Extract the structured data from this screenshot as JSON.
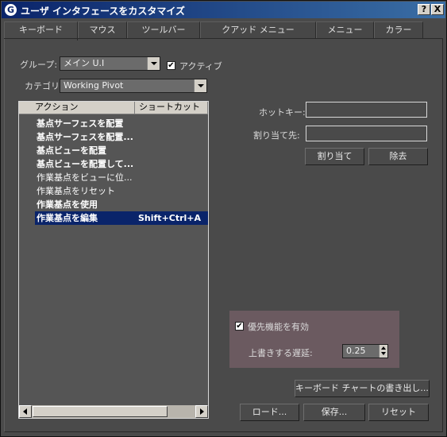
{
  "window": {
    "title": "ユーザ インタフェースをカスタマイズ",
    "help_label": "?",
    "close_label": "X"
  },
  "tabs": [
    {
      "label": "キーボード"
    },
    {
      "label": "マウス"
    },
    {
      "label": "ツールバー"
    },
    {
      "label": "クアッド メニュー"
    },
    {
      "label": "メニュー"
    },
    {
      "label": "カラー"
    }
  ],
  "group": {
    "label": "グループ:",
    "value": "メイン U.I",
    "active_label": "アクティブ",
    "active_checked": true
  },
  "category": {
    "label": "カテゴリ:",
    "value": "Working Pivot"
  },
  "list": {
    "col_action": "アクション",
    "col_shortcut": "ショートカット",
    "rows": [
      {
        "action": "基点サーフェスを配置",
        "shortcut": ""
      },
      {
        "action": "基点サーフェスを配置...",
        "shortcut": ""
      },
      {
        "action": "基点ビューを配置",
        "shortcut": ""
      },
      {
        "action": "基点ビューを配置して...",
        "shortcut": ""
      },
      {
        "action": "作業基点をビューに位...",
        "shortcut": ""
      },
      {
        "action": "作業基点をリセット",
        "shortcut": ""
      },
      {
        "action": "作業基点を使用",
        "shortcut": ""
      },
      {
        "action": "作業基点を編集",
        "shortcut": "Shift+Ctrl+A"
      }
    ]
  },
  "hotkey": {
    "label": "ホットキー:",
    "value": ""
  },
  "assigned_to": {
    "label": "割り当て先:",
    "value": ""
  },
  "buttons": {
    "assign": "割り当て",
    "remove": "除去",
    "export_chart": "キーボード チャートの書き出し...",
    "load": "ロード...",
    "save": "保存...",
    "reset": "リセット"
  },
  "priority": {
    "enable_label": "優先機能を有効",
    "enable_checked": true,
    "delay_label": "上書きする遅延:",
    "delay_value": "0.25"
  }
}
